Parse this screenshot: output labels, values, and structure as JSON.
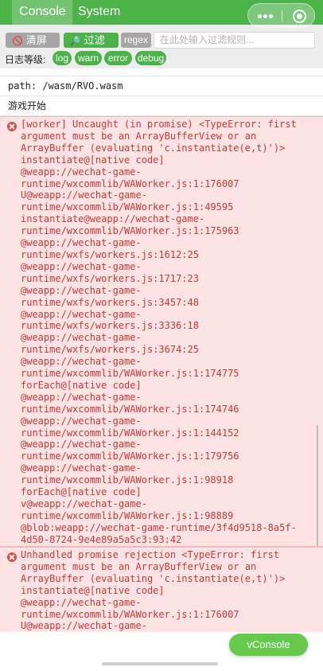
{
  "header": {
    "tabs": [
      {
        "label": "Console",
        "active": true
      },
      {
        "label": "System",
        "active": false
      }
    ],
    "accent_color": "#4cb34b"
  },
  "toolbar": {
    "clear_label": "清屏",
    "clear_icon": "no-entry-icon",
    "filter_label": "过滤",
    "filter_icon": "magnifier-icon",
    "regex_label": "regex",
    "filter_placeholder": "在此处输入过滤规则..."
  },
  "levels": {
    "label": "日志等级:",
    "items": [
      "log",
      "warn",
      "error",
      "debug"
    ]
  },
  "log": {
    "entries": [
      {
        "type": "log",
        "text": "path:  /wasm/RVO.wasm"
      },
      {
        "type": "log",
        "text": "游戏开始"
      },
      {
        "type": "error",
        "text": "[worker] Uncaught (in promise) <TypeError: first\nargument must be an ArrayBufferView or an\nArrayBuffer (evaluating 'c.instantiate(e,t)')>\ninstantiate@[native code]\n@weapp://wechat-game-\nruntime/wxcommlib/WAWorker.js:1:176007\nU@weapp://wechat-game-\nruntime/wxcommlib/WAWorker.js:1:49595\ninstantiate@weapp://wechat-game-\nruntime/wxcommlib/WAWorker.js:1:175963\n@weapp://wechat-game-\nruntime/wxfs/workers.js:1612:25\n@weapp://wechat-game-\nruntime/wxfs/workers.js:1717:23\n@weapp://wechat-game-\nruntime/wxfs/workers.js:3457:48\n@weapp://wechat-game-\nruntime/wxfs/workers.js:3336:18\n@weapp://wechat-game-\nruntime/wxfs/workers.js:3674:25\n@weapp://wechat-game-\nruntime/wxcommlib/WAWorker.js:1:174775\nforEach@[native code]\n@weapp://wechat-game-\nruntime/wxcommlib/WAWorker.js:1:174746\n@weapp://wechat-game-\nruntime/wxcommlib/WAWorker.js:1:144152\n@weapp://wechat-game-\nruntime/wxcommlib/WAWorker.js:1:179756\n@weapp://wechat-game-\nruntime/wxcommlib/WAWorker.js:1:98918\nforEach@[native code]\nv@weapp://wechat-game-\nruntime/wxcommlib/WAWorker.js:1:98889\n@blob:weapp://wechat-game-runtime/3f4d9518-8a5f-\n4d50-8724-9e4e89a5a5c3:93:42"
      },
      {
        "type": "error",
        "text": "Unhandled promise rejection <TypeError: first\nargument must be an ArrayBufferView or an\nArrayBuffer (evaluating 'c.instantiate(e,t)')>\ninstantiate@[native code]\n@weapp://wechat-game-\nruntime/wxcommlib/WAWorker.js:1:176007\nU@weapp://wechat-game-"
      }
    ]
  },
  "vconsole_button": "vConsole"
}
